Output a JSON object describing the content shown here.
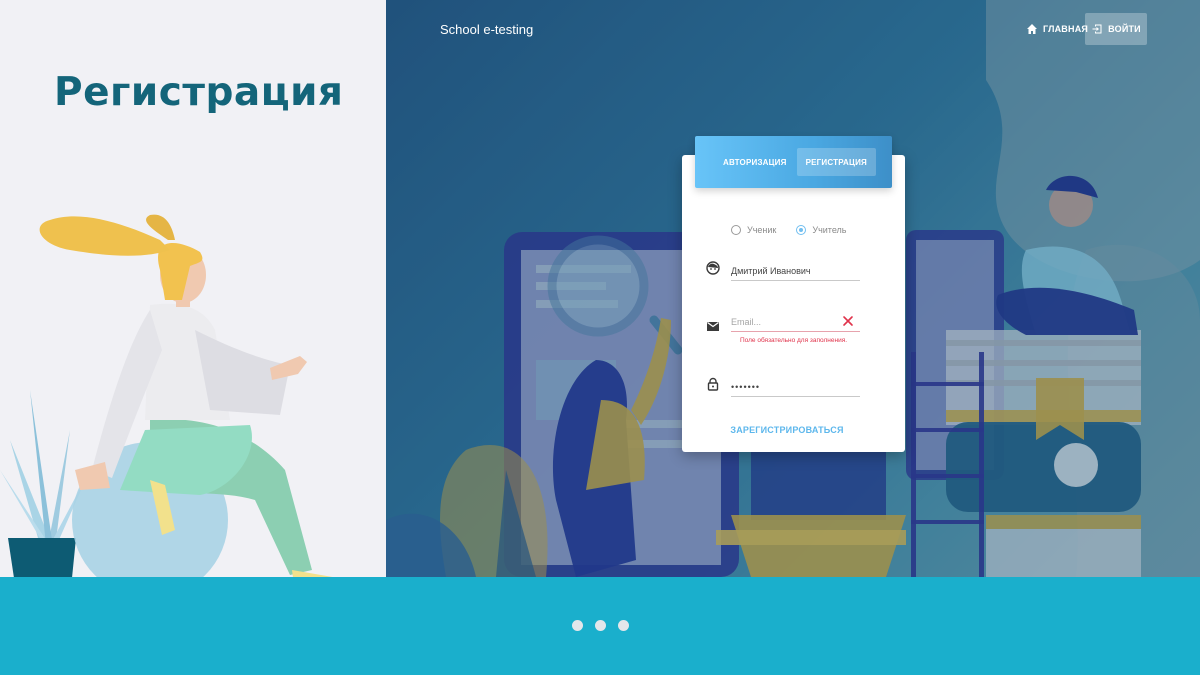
{
  "slide": {
    "title": "Регистрация"
  },
  "app": {
    "brand": "School e-testing"
  },
  "nav": {
    "home_label": "ГЛАВНАЯ",
    "login_label": "ВОЙТИ"
  },
  "auth": {
    "tabs": [
      {
        "label": "АВТОРИЗАЦИЯ",
        "active": false
      },
      {
        "label": "РЕГИСТРАЦИЯ",
        "active": true
      }
    ],
    "roles": [
      {
        "label": "Ученик",
        "selected": false
      },
      {
        "label": "Учитель",
        "selected": true
      }
    ],
    "name_value": "Дмитрий Иванович",
    "email_placeholder": "Email...",
    "email_error": "Поле обязательно для заполнения.",
    "password_value": "•••••••",
    "submit_label": "ЗАРЕГИСТРИРОВАТЬСЯ"
  },
  "icons": {
    "home": "home-icon",
    "login": "login-icon",
    "face": "face-icon",
    "mail": "mail-icon",
    "lock": "lock-icon",
    "clear": "close-icon"
  },
  "colors": {
    "title": "#14657a",
    "accent": "#5db7ec",
    "error": "#e0334b",
    "bottom_band": "#1aafcc"
  },
  "slider": {
    "count": 3
  }
}
